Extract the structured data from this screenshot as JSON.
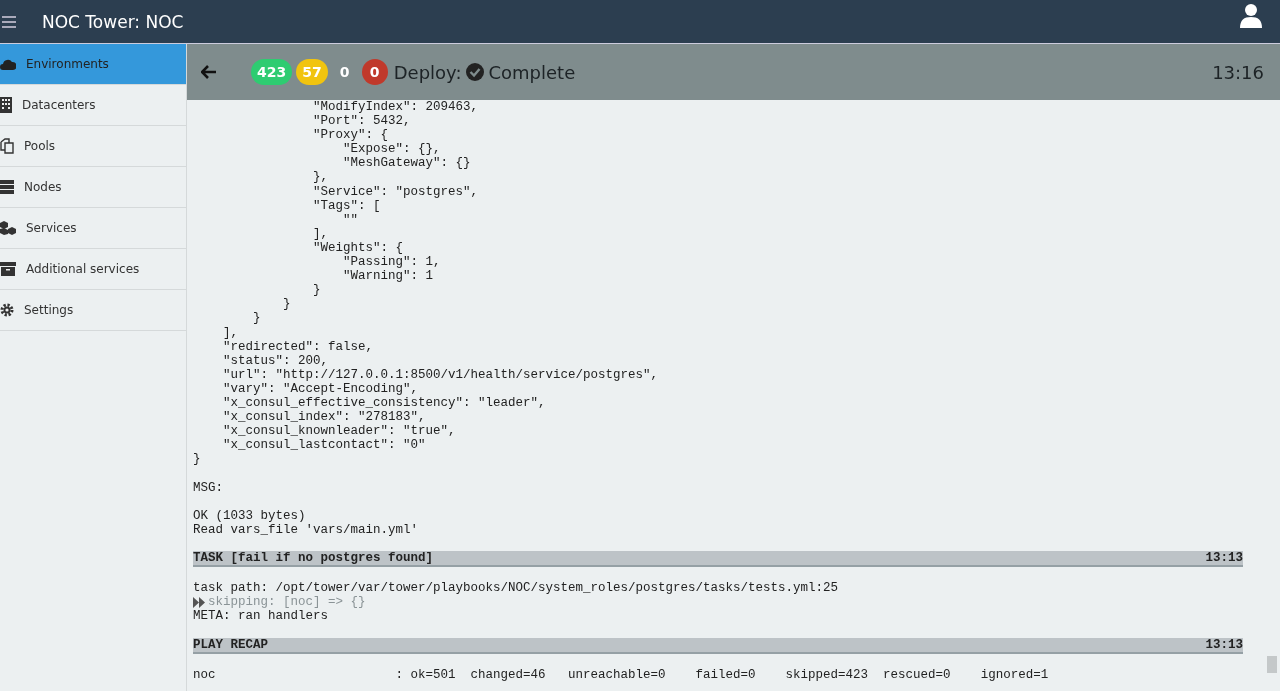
{
  "app_title": "NOC Tower: NOC",
  "sidebar": {
    "items": [
      {
        "label": "Environments",
        "selected": true
      },
      {
        "label": "Datacenters",
        "selected": false
      },
      {
        "label": "Pools",
        "selected": false
      },
      {
        "label": "Nodes",
        "selected": false
      },
      {
        "label": "Services",
        "selected": false
      },
      {
        "label": "Additional services",
        "selected": false
      },
      {
        "label": "Settings",
        "selected": false
      }
    ]
  },
  "job_header": {
    "badges": [
      {
        "text": "423",
        "color": "#2ecc71"
      },
      {
        "text": "57",
        "color": "#f1c40f"
      },
      {
        "text": "0"
      },
      {
        "text": "0",
        "color": "#c0392b"
      }
    ],
    "title": "Deploy:",
    "status": "Complete",
    "time": "13:16"
  },
  "log": [
    {
      "kind": "text",
      "text": "                \"ModifyIndex\": 209463,"
    },
    {
      "kind": "text",
      "text": "                \"Port\": 5432,"
    },
    {
      "kind": "text",
      "text": "                \"Proxy\": {"
    },
    {
      "kind": "text",
      "text": "                    \"Expose\": {},"
    },
    {
      "kind": "text",
      "text": "                    \"MeshGateway\": {}"
    },
    {
      "kind": "text",
      "text": "                },"
    },
    {
      "kind": "text",
      "text": "                \"Service\": \"postgres\","
    },
    {
      "kind": "text",
      "text": "                \"Tags\": ["
    },
    {
      "kind": "text",
      "text": "                    \"\""
    },
    {
      "kind": "text",
      "text": "                ],"
    },
    {
      "kind": "text",
      "text": "                \"Weights\": {"
    },
    {
      "kind": "text",
      "text": "                    \"Passing\": 1,"
    },
    {
      "kind": "text",
      "text": "                    \"Warning\": 1"
    },
    {
      "kind": "text",
      "text": "                }"
    },
    {
      "kind": "text",
      "text": "            }"
    },
    {
      "kind": "text",
      "text": "        }"
    },
    {
      "kind": "text",
      "text": "    ],"
    },
    {
      "kind": "text",
      "text": "    \"redirected\": false,"
    },
    {
      "kind": "text",
      "text": "    \"status\": 200,"
    },
    {
      "kind": "text",
      "text": "    \"url\": \"http://127.0.0.1:8500/v1/health/service/postgres\","
    },
    {
      "kind": "text",
      "text": "    \"vary\": \"Accept-Encoding\","
    },
    {
      "kind": "text",
      "text": "    \"x_consul_effective_consistency\": \"leader\","
    },
    {
      "kind": "text",
      "text": "    \"x_consul_index\": \"278183\","
    },
    {
      "kind": "text",
      "text": "    \"x_consul_knownleader\": \"true\","
    },
    {
      "kind": "text",
      "text": "    \"x_consul_lastcontact\": \"0\""
    },
    {
      "kind": "text",
      "text": "}"
    },
    {
      "kind": "blank"
    },
    {
      "kind": "text",
      "text": "MSG:"
    },
    {
      "kind": "blank"
    },
    {
      "kind": "text",
      "text": "OK (1033 bytes)"
    },
    {
      "kind": "text",
      "text": "Read vars_file 'vars/main.yml'"
    },
    {
      "kind": "blank"
    },
    {
      "kind": "header",
      "text": "TASK [fail if no postgres found]",
      "time": "13:13"
    },
    {
      "kind": "blank"
    },
    {
      "kind": "text",
      "text": "task path: /opt/tower/var/tower/playbooks/NOC/system_roles/postgres/tasks/tests.yml:25"
    },
    {
      "kind": "skip",
      "text": "skipping: [noc] => {}"
    },
    {
      "kind": "text",
      "text": "META: ran handlers"
    },
    {
      "kind": "blank"
    },
    {
      "kind": "header",
      "text": "PLAY RECAP",
      "time": "13:13"
    },
    {
      "kind": "blank"
    },
    {
      "kind": "text",
      "text": "noc                        : ok=501  changed=46   unreachable=0    failed=0    skipped=423  rescued=0    ignored=1"
    }
  ]
}
